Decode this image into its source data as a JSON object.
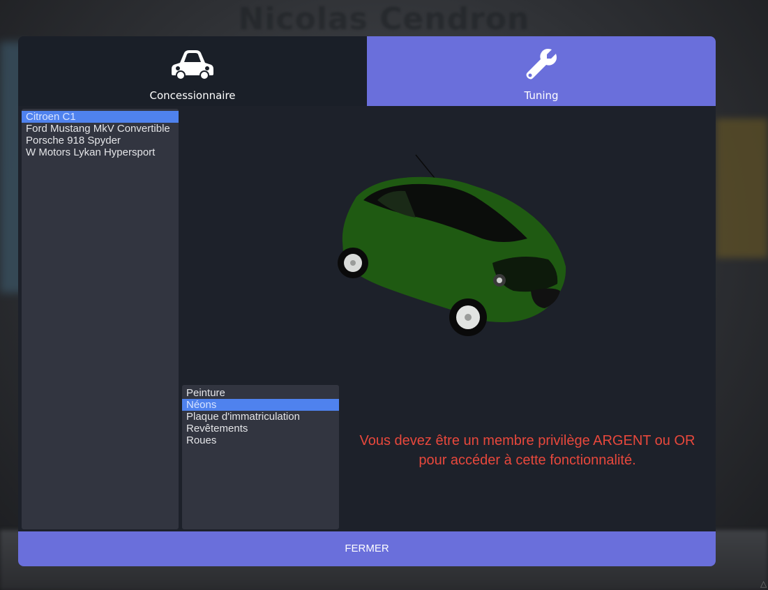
{
  "background": {
    "player_name": "Nicolas Cendron"
  },
  "tabs": [
    {
      "label": "Concessionnaire",
      "icon": "car-icon",
      "active": false
    },
    {
      "label": "Tuning",
      "icon": "wrench-icon",
      "active": true
    }
  ],
  "vehicles": {
    "selected_index": 0,
    "items": [
      {
        "label": "Citroen C1"
      },
      {
        "label": "Ford Mustang MkV Convertible"
      },
      {
        "label": "Porsche 918 Spyder"
      },
      {
        "label": "W Motors Lykan Hypersport"
      }
    ]
  },
  "tuning": {
    "selected_index": 1,
    "items": [
      {
        "label": "Peinture"
      },
      {
        "label": "Néons"
      },
      {
        "label": "Plaque d'immatriculation"
      },
      {
        "label": "Revêtements"
      },
      {
        "label": "Roues"
      }
    ]
  },
  "warning": {
    "line1": "Vous devez être un membre privilège ARGENT ou OR",
    "line2": "pour accéder à cette fonctionnalité."
  },
  "footer": {
    "close_label": "FERMER"
  },
  "colors": {
    "accent": "#6a6fdb",
    "selection": "#4f82ee",
    "warning": "#e8483c",
    "car_body": "#1f5a12"
  }
}
